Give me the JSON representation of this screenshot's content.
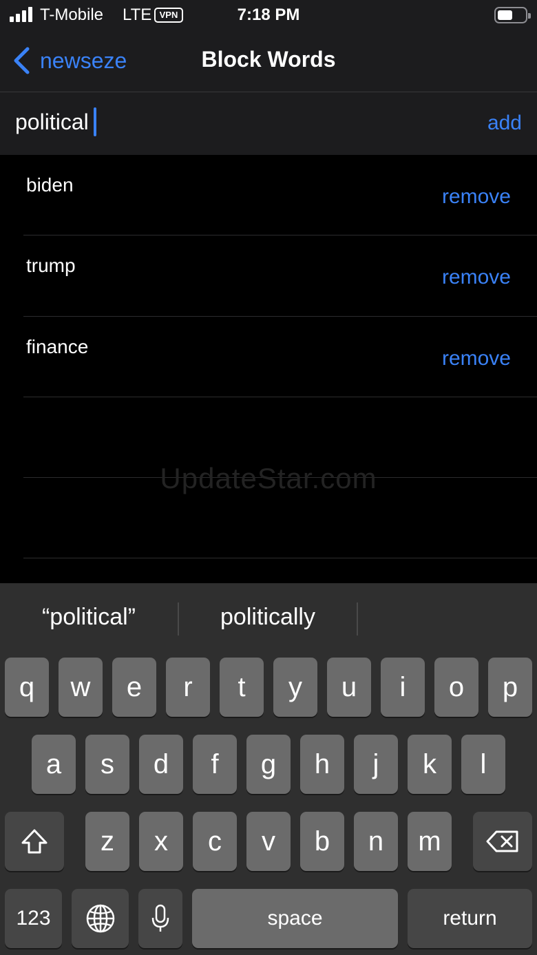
{
  "status_bar": {
    "carrier": "T-Mobile",
    "network": "LTE",
    "vpn_badge": "VPN",
    "time": "7:18 PM",
    "battery_level": 0.55
  },
  "nav": {
    "back_label": "newseze",
    "title": "Block Words"
  },
  "input": {
    "value": "political",
    "add_label": "add"
  },
  "blocked_words": [
    {
      "word": "biden",
      "action": "remove"
    },
    {
      "word": "trump",
      "action": "remove"
    },
    {
      "word": "finance",
      "action": "remove"
    }
  ],
  "watermark": "UpdateStar.com",
  "keyboard": {
    "suggestions": [
      "“political”",
      "politically"
    ],
    "row1": [
      "q",
      "w",
      "e",
      "r",
      "t",
      "y",
      "u",
      "i",
      "o",
      "p"
    ],
    "row2": [
      "a",
      "s",
      "d",
      "f",
      "g",
      "h",
      "j",
      "k",
      "l"
    ],
    "row3": [
      "z",
      "x",
      "c",
      "v",
      "b",
      "n",
      "m"
    ],
    "numbers_label": "123",
    "space_label": "space",
    "return_label": "return",
    "icons": [
      "shift-icon",
      "delete-icon",
      "globe-icon",
      "microphone-icon"
    ]
  },
  "colors": {
    "accent": "#3a82f7",
    "bar_background": "#1c1c1e",
    "keyboard_background": "#2f2f2f",
    "key_light": "#6b6b6b",
    "key_dark": "#464646"
  }
}
